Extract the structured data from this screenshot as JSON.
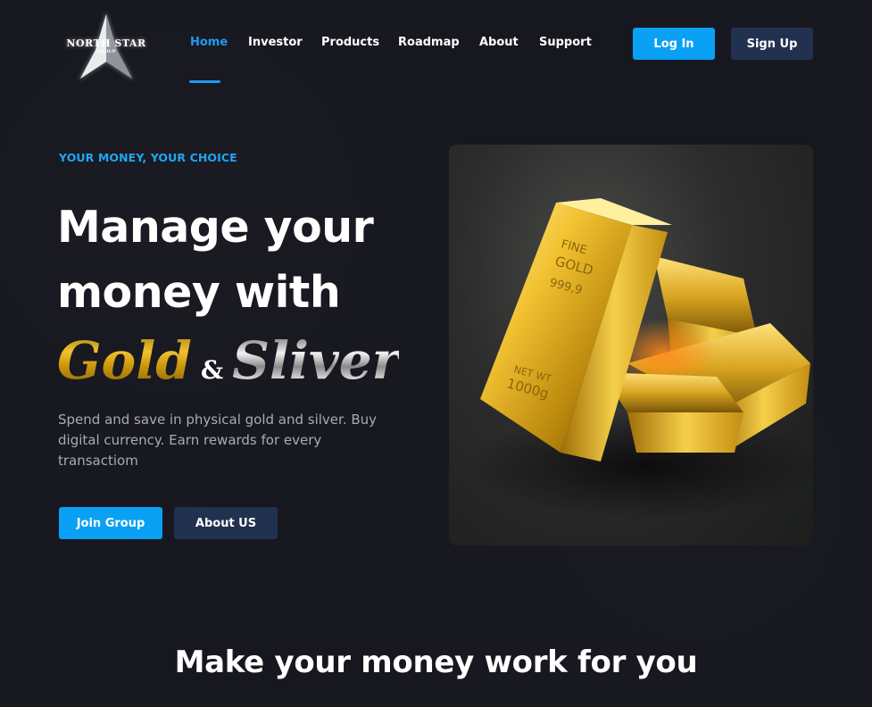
{
  "brand": {
    "name": "NORTH STAR",
    "sub": "GROUP",
    "logo_icon": "star-icon"
  },
  "nav": {
    "items": [
      {
        "label": "Home",
        "active": true
      },
      {
        "label": "Investor",
        "active": false
      },
      {
        "label": "Products",
        "active": false
      },
      {
        "label": "Roadmap",
        "active": false
      },
      {
        "label": "About",
        "active": false
      },
      {
        "label": "Support",
        "active": false
      }
    ],
    "login_label": "Log In",
    "signup_label": "Sign Up"
  },
  "hero": {
    "eyebrow": "YOUR MONEY, YOUR CHOICE",
    "title": "Manage your money with",
    "metal_gold": "Gold",
    "metal_amp": "&",
    "metal_silver": "Sliver",
    "description": "Spend and save in physical gold and silver. Buy digital currency. Earn rewards for every transactiom",
    "primary_cta": "Join Group",
    "secondary_cta": "About US",
    "image_alt_icon": "gold-bars-image"
  },
  "section": {
    "title": "Make your money work for you"
  },
  "colors": {
    "background": "#17171f",
    "accent": "#0aa0f4",
    "navy_button": "#233150",
    "gold": "#f2c12e",
    "silver": "#d8d8d8"
  }
}
